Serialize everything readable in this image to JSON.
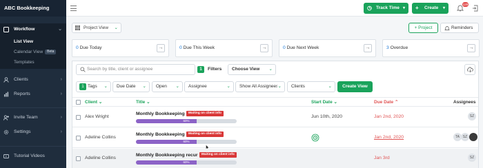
{
  "app": {
    "brand": "ABC Bookkeeping"
  },
  "sidebar": {
    "workflow": "Workflow",
    "list_view": "List View",
    "calendar_view": "Calendar View",
    "beta": "Beta",
    "templates": "Templates",
    "clients": "Clients",
    "reports": "Reports",
    "invite_team": "Invite Team",
    "settings": "Settings",
    "tutorial_videos": "Tutorial Videos"
  },
  "topbar": {
    "track_time": "Track Time",
    "create": "Create",
    "notification_count": "129"
  },
  "toolbar": {
    "project_view": "Project View",
    "project_button": "+ Project",
    "reminders": "Reminders"
  },
  "stats": [
    {
      "count": "0",
      "label": "Due Today"
    },
    {
      "count": "0",
      "label": "Due This Week"
    },
    {
      "count": "0",
      "label": "Due Next Week"
    },
    {
      "count": "3",
      "label": "Overdue"
    }
  ],
  "filters": {
    "search_placeholder": "Search by title, client or assignee",
    "filters_count": "1",
    "filters_label": "Filters",
    "choose_view": "Choose View",
    "tags_count": "1",
    "tags": "Tags",
    "due_date": "Due Date",
    "status": "Open",
    "assignee": "Assignee",
    "show_all": "Show All Assignees",
    "clients": "Clients",
    "create_view": "Create View"
  },
  "table": {
    "headers": {
      "client": "Client",
      "title": "Title",
      "start_date": "Start Date",
      "due_date": "Due Date",
      "assignees": "Assignees"
    },
    "rows": [
      {
        "client": "Alex Wright",
        "title": "Monthly Bookkeeping",
        "badge": "Waiting on client info",
        "progress_pct": 60,
        "progress_label": "60%",
        "start_date": "Jun 10th, 2020",
        "due_date": "Jan 2nd, 2020",
        "assignees": [
          "SZ"
        ]
      },
      {
        "client": "Adeline Collins",
        "title": "Monthly Bookkeeping",
        "badge": "Waiting on client info",
        "progress_pct": 60,
        "progress_label": "60%",
        "start_date": "",
        "due_date": "Jan 2nd, 2020",
        "assignees": [
          "TA",
          "SZ",
          "photo"
        ]
      },
      {
        "client": "Adeline Collins",
        "title": "Monthly Bookkeeping recur",
        "badge": "Waiting on client info",
        "progress_pct": 60,
        "progress_label": "60%",
        "start_date": "",
        "due_date": "Jan 3rd",
        "assignees": [
          "SZ"
        ]
      }
    ]
  },
  "colors": {
    "accent": "#1aa35b",
    "danger": "#d93838",
    "progress": "#8c63c7",
    "sidebar": "#1f2d3d"
  }
}
